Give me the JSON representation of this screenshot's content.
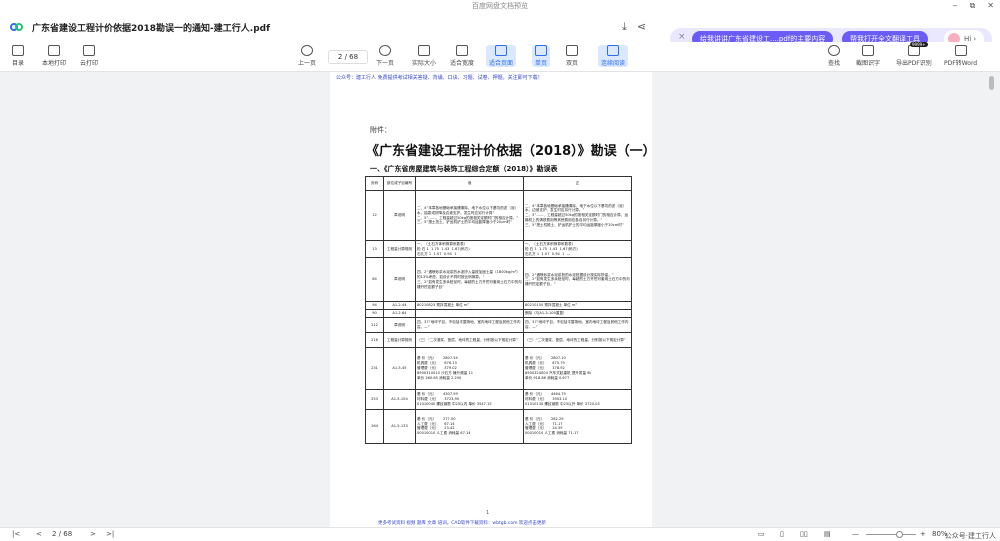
{
  "window": {
    "title": "百度网盘文档预览",
    "controls": [
      "‒",
      "⧉",
      "✕"
    ]
  },
  "file": {
    "name": "广东省建设工程计价依据2018勘误一的通知-建工行人.pdf"
  },
  "ai": {
    "close": "×",
    "chip1": "给我讲讲广东省建设工....pdf的主要内容",
    "chip2": "帮我打开全文翻译工具",
    "hi": "Hi ›",
    "badge": "9999+"
  },
  "toolbar": {
    "left": [
      "目录",
      "本地打印",
      "云打印"
    ],
    "prev": "上一页",
    "page_indicator": "2 / 68",
    "next": "下一页",
    "views": [
      "实际大小",
      "适合宽度",
      "适合页面",
      "单页",
      "双页",
      "连续阅读"
    ],
    "right": [
      "查找",
      "截图识字",
      "导出PDF识别",
      "PDF转Word"
    ]
  },
  "doc": {
    "header": "公众号：建工行人 免费提供考试相关答疑、背诵、口诀、习题、试卷、押题，关注即可下载！",
    "attach": "附件：",
    "title": "《广东省建设工程计价依据（2018）》勘误（一）",
    "section": "一、《广东省房屋建筑与装饰工程综合定额（2018）》勘误表",
    "columns": [
      "页码",
      "部位或子目编号",
      "误",
      "正"
    ],
    "rows": [
      {
        "page": "12",
        "part": "章说明",
        "wrong": "二、4“本章各地基础承接槽清除、地下水位以下基坑的淤（泥）水、抽泵或挤降及边坡支护，发生时应另行计算”\n二、5“……、工程量超过50kg的按相关定额时门的相应计算。”\n三、5“搭土挡土、铲运机铲土的平均运距厚度小于20cm时”",
        "right": "二、4“本章各地基础承接槽清除、地下水位以下基坑的淤（泥）水、边坡支护、发生时应另行计算。”\n二、5“……、工程量超过50kg的按相关定额时门的相应计算，运输机上的清铁费用等其他费用应各自另行计算。”\n三、5“搭土机推土、铲运机铲土的平均运距厚度小于20cm时”"
      },
      {
        "page": "13",
        "part": "工程量计算规则",
        "wrong": "一、（土石方体积换算系数表）\n松 石 1  1.75  1.43  1.67(码方)\n石孔方 1  1.07  0.94  1",
        "right": "一、（土石方体积换算系数表）\n松 石 1  1.75  1.43  1.67(码方)\n石孔方 1  1.07  0.94  1  —"
      },
      {
        "page": "64",
        "part": "章说明",
        "wrong": "四、2“遇喷砂浆水泥浆的水泥掺入量按加固土量（1800kg/m³）的13%考虑，如设计不同时按比例换算。”\n三、2“如有发生多余桩径时，每超的土方开挖可套用土石方中的沟槽开挖定额子目”",
        "right": "四、2“遇喷砂浆水泥浆桩的水泥桩据设计按实际掺量。”\n三、2“如有发生多余桩径时，每超的土方开挖可套用土石方中的沟槽开挖定额子目，”"
      },
      {
        "page": "94",
        "part": "A1-2-44",
        "wrong": "80210823 预拌混凝土 单位 m³",
        "right": "80210150 预拌混凝土 单位 m³"
      },
      {
        "page": "90",
        "part": "A1-2-64",
        "wrong": "",
        "right": "删除（与A1-3-100重复）"
      },
      {
        "page": "212",
        "part": "章说明",
        "wrong": "四、37“地坪子目，不包括平整场地、室内地坪工程及其他工作内容，—”",
        "right": "四、37“地坪子目，不包括平整场地，室内地坪工程及其他工作内容，—”"
      },
      {
        "page": "216",
        "part": "工程量计算规则",
        "wrong": "（三）“二次灌浆、垫层、地坪的工程量，分别按以下规定计算”",
        "right": "（三）“二次灌浆、垫层、地坪的工程量，分别按以下规定计算”"
      },
      {
        "page": "231",
        "part": "A1-5-45",
        "wrong": "基 价（元）      2807.54\n机具费（元）     676.13\n管理费（元）     379.02\n8900310010 沙石方 锤升频量 11\n单价 260.65 消耗量 2.290",
        "right": "基 价（元）      2807.10\n机具费（元）     675.79\n管理费（元）     378.92\n8900324004 汽车式起重机 提升质量 8t\n单价 918.86 消耗量 0.677"
      },
      {
        "page": "253",
        "part": "A1-5-104",
        "wrong": "基 价（元）      4307.59\n材料费（元）     3723.90\n01010040 螺纹钢筋 中25以内 单价 3547.15",
        "right": "基 价（元）      4464.79\n材料费（元）     3903.10\n01010130 螺纹钢筋 中25以外 单价 3720.03"
      },
      {
        "page": "264",
        "part": "A1-5-133",
        "wrong": "基 价（元）      277.00\n人工费（元）     67.14\n管理费（元）     23.42\n00010010 人工费 消耗量 67.14",
        "right": "基 价（元）      282.29\n人工费（元）     71.17\n管理费（元）     24.59\n00010010 人工费 消耗量 71.17"
      }
    ],
    "page_number": "1",
    "footer": "更多考试资料 视频 题库 文章 培训，CAD软件下载资料：wbtgb.com 欢迎点击更新"
  },
  "bottom": {
    "first": "|<",
    "prev": "<",
    "page": "2 / 68",
    "next": ">",
    "last": ">|",
    "zoom": "80%",
    "zoom_minus": "—",
    "zoom_plus": "+",
    "watermark": "公众号·建工行人"
  }
}
